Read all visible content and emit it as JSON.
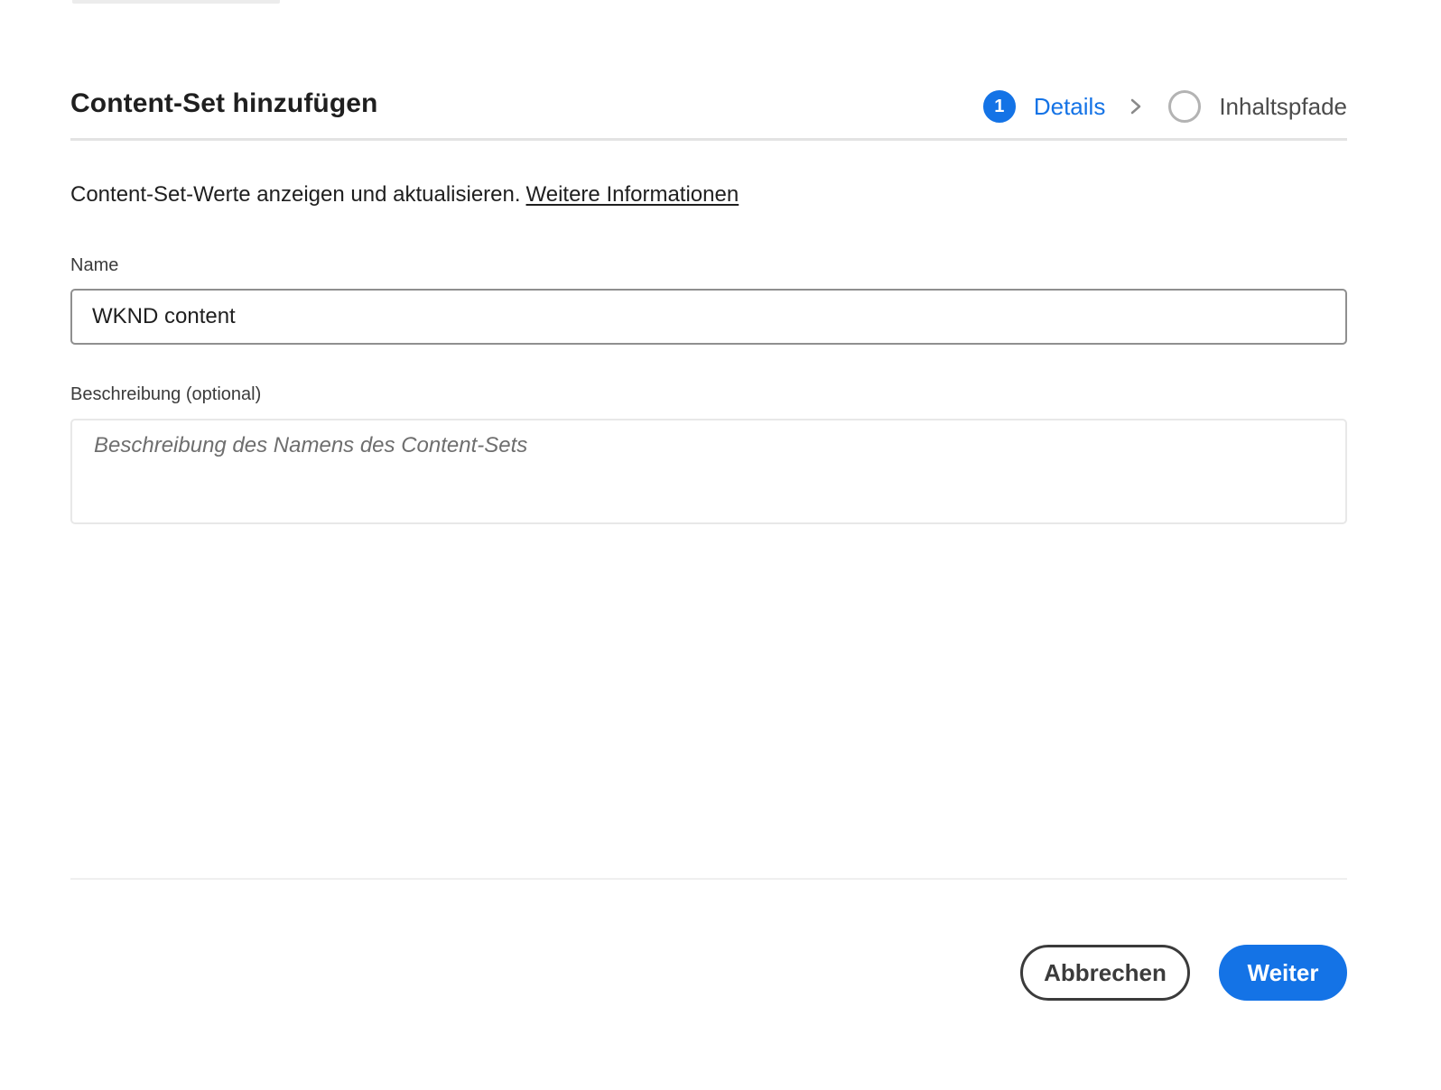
{
  "dialog": {
    "title": "Content-Set hinzufügen",
    "accent_color": "#1473e6"
  },
  "stepper": {
    "steps": [
      {
        "number": "1",
        "label": "Details",
        "state": "active"
      },
      {
        "number": "",
        "label": "Inhaltspfade",
        "state": "inactive"
      }
    ],
    "separator_icon": "chevron-right-icon"
  },
  "intro": {
    "text": "Content-Set-Werte anzeigen und aktualisieren.",
    "link_label": "Weitere Informationen"
  },
  "form": {
    "name": {
      "label": "Name",
      "value": "WKND content"
    },
    "description": {
      "label": "Beschreibung (optional)",
      "value": "",
      "placeholder": "Beschreibung des Namens des Content-Sets"
    }
  },
  "footer": {
    "cancel_label": "Abbrechen",
    "next_label": "Weiter"
  }
}
